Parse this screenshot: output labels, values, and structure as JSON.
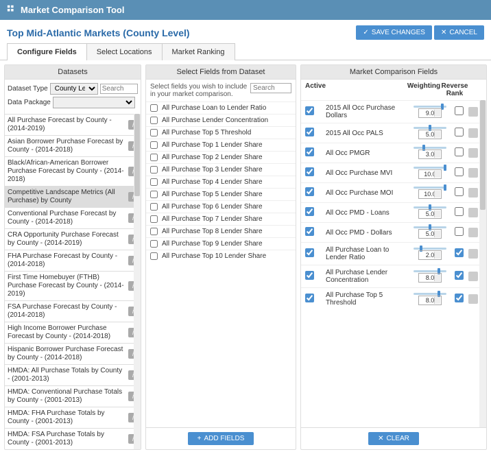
{
  "header": {
    "title": "Market Comparison Tool"
  },
  "page": {
    "title": "Top Mid-Atlantic Markets (County Level)"
  },
  "actions": {
    "save": "SAVE CHANGES",
    "cancel": "CANCEL"
  },
  "tabs": {
    "configure": "Configure Fields",
    "locations": "Select Locations",
    "ranking": "Market Ranking"
  },
  "col1": {
    "title": "Datasets",
    "dataset_type_label": "Dataset Type",
    "dataset_type_value": "County Level",
    "search_placeholder": "Search",
    "data_package_label": "Data Package",
    "items": [
      {
        "label": "All Purchase Forecast by County - (2014-2019)",
        "selected": false
      },
      {
        "label": "Asian Borrower Purchase Forecast by County - (2014-2018)",
        "selected": false
      },
      {
        "label": "Black/African-American Borrower Purchase Forecast by County - (2014-2018)",
        "selected": false
      },
      {
        "label": "Competitive Landscape Metrics (All Purchase) by County",
        "selected": true
      },
      {
        "label": "Conventional Purchase Forecast by County - (2014-2018)",
        "selected": false
      },
      {
        "label": "CRA Opportunity Purchase Forecast by County - (2014-2019)",
        "selected": false
      },
      {
        "label": "FHA Purchase Forecast by County - (2014-2018)",
        "selected": false
      },
      {
        "label": "First Time Homebuyer (FTHB) Purchase Forecast by County - (2014-2019)",
        "selected": false
      },
      {
        "label": "FSA Purchase Forecast by County - (2014-2018)",
        "selected": false
      },
      {
        "label": "High Income Borrower Purchase Forecast by County - (2014-2018)",
        "selected": false
      },
      {
        "label": "Hispanic Borrower Purchase Forecast by County - (2014-2018)",
        "selected": false
      },
      {
        "label": "HMDA: All Purchase Totals by County - (2001-2013)",
        "selected": false
      },
      {
        "label": "HMDA: Conventional Purchase Totals by County - (2001-2013)",
        "selected": false
      },
      {
        "label": "HMDA: FHA Purchase Totals by County - (2001-2013)",
        "selected": false
      },
      {
        "label": "HMDA: FSA Purchase Totals by County - (2001-2013)",
        "selected": false
      }
    ]
  },
  "col2": {
    "title": "Select Fields from Dataset",
    "desc": "Select fields you wish to include in your market comparison.",
    "search_placeholder": "Search",
    "items": [
      "All Purchase Loan to Lender Ratio",
      "All Purchase Lender Concentration",
      "All Purchase Top 5 Threshold",
      "All Purchase Top 1 Lender Share",
      "All Purchase Top 2 Lender Share",
      "All Purchase Top 3 Lender Share",
      "All Purchase Top 4 Lender Share",
      "All Purchase Top 5 Lender Share",
      "All Purchase Top 6 Lender Share",
      "All Purchase Top 7 Lender Share",
      "All Purchase Top 8 Lender Share",
      "All Purchase Top 9 Lender Share",
      "All Purchase Top 10 Lender Share"
    ],
    "add_btn": "ADD FIELDS"
  },
  "col3": {
    "title": "Market Comparison Fields",
    "h_active": "Active",
    "h_weight": "Weighting",
    "h_rev": "Reverse Rank",
    "items": [
      {
        "name": "2015 All Occ Purchase Dollars",
        "weight": "9.0",
        "rev": false
      },
      {
        "name": "2015 All Occ PALS",
        "weight": "5.0",
        "rev": false
      },
      {
        "name": "All Occ PMGR",
        "weight": "3.0",
        "rev": false
      },
      {
        "name": "All Occ Purchase MVI",
        "weight": "10.0",
        "rev": false
      },
      {
        "name": "All Occ Purchase MOI",
        "weight": "10.0",
        "rev": false
      },
      {
        "name": "All Occ PMD - Loans",
        "weight": "5.0",
        "rev": false
      },
      {
        "name": "All Occ PMD - Dollars",
        "weight": "5.0",
        "rev": false
      },
      {
        "name": "All Purchase Loan to Lender Ratio",
        "weight": "2.0",
        "rev": true
      },
      {
        "name": "All Purchase Lender Concentration",
        "weight": "8.0",
        "rev": true
      },
      {
        "name": "All Purchase Top 5 Threshold",
        "weight": "8.0",
        "rev": true
      }
    ],
    "clear_btn": "CLEAR"
  }
}
